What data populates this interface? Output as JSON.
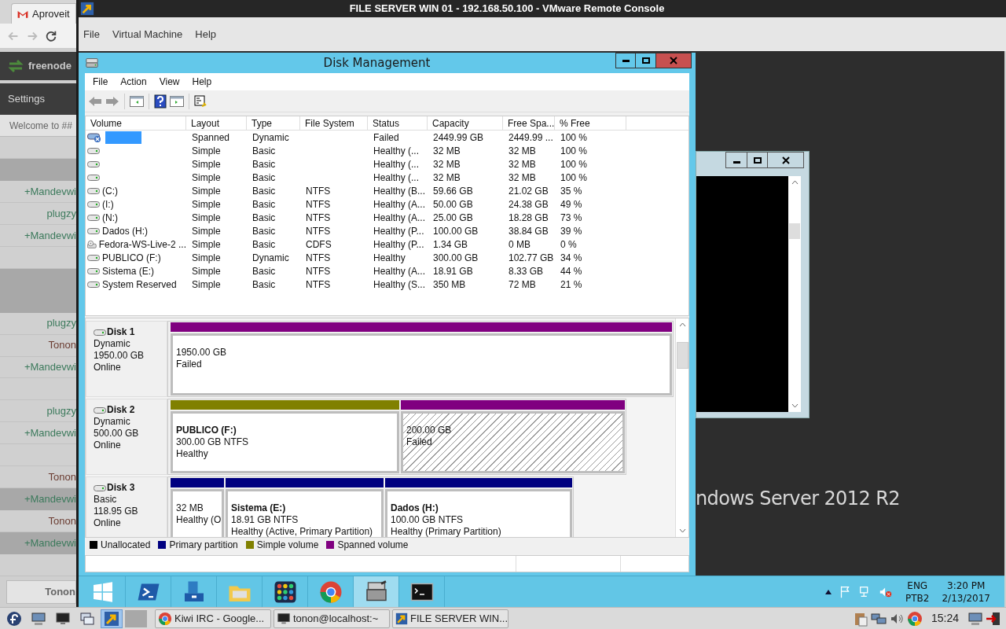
{
  "browser": {
    "tab_title": "Aproveit",
    "server": "freenode",
    "settings": "Settings",
    "topic": "Welcome to ##",
    "messages": [
      {
        "highlighted": false
      },
      {
        "highlighted": true
      },
      {
        "nick": "+Mandevwi",
        "color": "#3c7a5c",
        "highlighted": false
      },
      {
        "nick": "plugzy",
        "color": "#3c7a5c",
        "highlighted": false
      },
      {
        "nick": "+Mandevwi",
        "color": "#3c7a5c",
        "highlighted": false
      },
      {
        "highlighted": false
      },
      {
        "highlighted": true
      },
      {
        "highlighted": true
      },
      {
        "nick": "plugzy",
        "color": "#3c7a5c",
        "highlighted": false
      },
      {
        "nick": "Tonon",
        "color": "#6a3b30",
        "highlighted": false
      },
      {
        "nick": "+Mandevwi",
        "color": "#3c7a5c",
        "highlighted": false
      },
      {
        "highlighted": false
      },
      {
        "nick": "plugzy",
        "color": "#3c7a5c",
        "highlighted": false
      },
      {
        "nick": "+Mandevwi",
        "color": "#3c7a5c",
        "highlighted": false
      },
      {
        "highlighted": false
      },
      {
        "nick": "Tonon",
        "color": "#6a3b30",
        "highlighted": false
      },
      {
        "nick": "+Mandevwi",
        "color": "#3c7a5c",
        "highlighted": true
      },
      {
        "nick": "Tonon",
        "color": "#6a3b30",
        "highlighted": false
      },
      {
        "nick": "+Mandevwi",
        "color": "#3c7a5c",
        "highlighted": true
      },
      {
        "highlighted": false
      }
    ],
    "footer_button": "Tonon"
  },
  "vmware": {
    "title": "FILE SERVER WIN 01 - 192.168.50.100 - VMware Remote Console",
    "menu": [
      "File",
      "Virtual Machine",
      "Help"
    ]
  },
  "disk_management": {
    "title": "Disk Management",
    "menu": [
      "File",
      "Action",
      "View",
      "Help"
    ],
    "columns": [
      "Volume",
      "Layout",
      "Type",
      "File System",
      "Status",
      "Capacity",
      "Free Spa...",
      "% Free"
    ],
    "rows": [
      {
        "kind": "failed",
        "selected": true,
        "layout": "Spanned",
        "type": "Dynamic",
        "status": "Failed",
        "capacity": "2449.99 GB",
        "free_space": "2449.99 ...",
        "percent_free": "100 %"
      },
      {
        "kind": "disk",
        "selected": false,
        "layout": "Simple",
        "type": "Basic",
        "status": "Healthy (...",
        "capacity": "32 MB",
        "free_space": "32 MB",
        "percent_free": "100 %"
      },
      {
        "kind": "disk",
        "selected": false,
        "layout": "Simple",
        "type": "Basic",
        "status": "Healthy (...",
        "capacity": "32 MB",
        "free_space": "32 MB",
        "percent_free": "100 %"
      },
      {
        "kind": "disk",
        "selected": false,
        "layout": "Simple",
        "type": "Basic",
        "status": "Healthy (...",
        "capacity": "32 MB",
        "free_space": "32 MB",
        "percent_free": "100 %"
      },
      {
        "kind": "disk",
        "selected": false,
        "volume": "(C:)",
        "layout": "Simple",
        "type": "Basic",
        "file_system": "NTFS",
        "status": "Healthy (B...",
        "capacity": "59.66 GB",
        "free_space": "21.02 GB",
        "percent_free": "35 %"
      },
      {
        "kind": "disk",
        "selected": false,
        "volume": "(I:)",
        "layout": "Simple",
        "type": "Basic",
        "file_system": "NTFS",
        "status": "Healthy (A...",
        "capacity": "50.00 GB",
        "free_space": "24.38 GB",
        "percent_free": "49 %"
      },
      {
        "kind": "disk",
        "selected": false,
        "volume": "(N:)",
        "layout": "Simple",
        "type": "Basic",
        "file_system": "NTFS",
        "status": "Healthy (A...",
        "capacity": "25.00 GB",
        "free_space": "18.28 GB",
        "percent_free": "73 %"
      },
      {
        "kind": "disk",
        "selected": false,
        "volume": "Dados (H:)",
        "layout": "Simple",
        "type": "Basic",
        "file_system": "NTFS",
        "status": "Healthy (P...",
        "capacity": "100.00 GB",
        "free_space": "38.84 GB",
        "percent_free": "39 %"
      },
      {
        "kind": "cdrom",
        "selected": false,
        "volume": "Fedora-WS-Live-2 ...",
        "layout": "Simple",
        "type": "Basic",
        "file_system": "CDFS",
        "status": "Healthy (P...",
        "capacity": "1.34 GB",
        "free_space": "0 MB",
        "percent_free": "0 %"
      },
      {
        "kind": "disk",
        "selected": false,
        "volume": "PUBLICO (F:)",
        "layout": "Simple",
        "type": "Dynamic",
        "file_system": "NTFS",
        "status": "Healthy",
        "capacity": "300.00 GB",
        "free_space": "102.77 GB",
        "percent_free": "34 %"
      },
      {
        "kind": "disk",
        "selected": false,
        "volume": "Sistema (E:)",
        "layout": "Simple",
        "type": "Basic",
        "file_system": "NTFS",
        "status": "Healthy (A...",
        "capacity": "18.91 GB",
        "free_space": "8.33 GB",
        "percent_free": "44 %"
      },
      {
        "kind": "disk",
        "selected": false,
        "volume": "System Reserved",
        "layout": "Simple",
        "type": "Basic",
        "file_system": "NTFS",
        "status": "Healthy (S...",
        "capacity": "350 MB",
        "free_space": "72 MB",
        "percent_free": "21 %"
      }
    ],
    "disks": [
      {
        "name": "Disk 1",
        "type": "Dynamic",
        "size": "1950.00 GB",
        "status": "Online",
        "partitions": [
          {
            "kind": "spanned",
            "missing": false,
            "lines": [
              "1950.00 GB",
              "Failed"
            ]
          }
        ]
      },
      {
        "name": "Disk 2",
        "type": "Dynamic",
        "size": "500.00 GB",
        "status": "Online",
        "partitions": [
          {
            "kind": "simple",
            "missing": false,
            "title": "PUBLICO  (F:)",
            "lines": [
              "300.00 GB NTFS",
              "Healthy"
            ]
          },
          {
            "kind": "spanned",
            "missing": true,
            "lines": [
              "200.00 GB",
              "Failed"
            ]
          }
        ]
      },
      {
        "name": "Disk 3",
        "type": "Basic",
        "size": "118.95 GB",
        "status": "Online",
        "partitions": [
          {
            "kind": "primary",
            "missing": false,
            "lines": [
              "32 MB",
              "Healthy (O"
            ]
          },
          {
            "kind": "primary",
            "missing": false,
            "title": "Sistema  (E:)",
            "lines": [
              "18.91 GB NTFS",
              "Healthy (Active, Primary Partition)"
            ]
          },
          {
            "kind": "primary",
            "missing": false,
            "title": "Dados  (H:)",
            "lines": [
              "100.00 GB NTFS",
              "Healthy (Primary Partition)"
            ]
          }
        ]
      }
    ],
    "legend": [
      {
        "label": "Unallocated",
        "color": "#000000"
      },
      {
        "label": "Primary partition",
        "color": "#000080"
      },
      {
        "label": "Simple volume",
        "color": "#808000"
      },
      {
        "label": "Spanned volume",
        "color": "#800080"
      }
    ]
  },
  "guest_desktop": {
    "text": "ndows Server 2012 R2"
  },
  "guest_taskbar": {
    "apps": [
      {
        "kind": "windows",
        "selected": false
      },
      {
        "kind": "powershell",
        "selected": false
      },
      {
        "kind": "server",
        "selected": false
      },
      {
        "kind": "folder",
        "selected": false
      },
      {
        "kind": "grid",
        "selected": false
      },
      {
        "kind": "chrome",
        "selected": false
      },
      {
        "kind": "diskmgmt",
        "selected": true
      },
      {
        "kind": "cmd",
        "selected": false
      }
    ],
    "tray": {
      "language": "ENG",
      "layout": "PTB2",
      "time": "3:20 PM",
      "date": "2/13/2017"
    }
  },
  "host_taskbar": {
    "launchers": [
      {
        "kind": "fedora",
        "selected": false
      },
      {
        "kind": "computer",
        "selected": false
      },
      {
        "kind": "monitor",
        "selected": false
      },
      {
        "kind": "windows",
        "selected": false
      },
      {
        "kind": "vmware",
        "selected": true
      },
      {
        "kind": "blank",
        "selected": false
      }
    ],
    "tasks": [
      {
        "kind": "chrome",
        "label": "Kiwi IRC - Google..."
      },
      {
        "kind": "terminal",
        "label": "tonon@localhost:~"
      },
      {
        "kind": "vmware",
        "label": "FILE SERVER WIN..."
      }
    ],
    "clock": "15:24"
  }
}
